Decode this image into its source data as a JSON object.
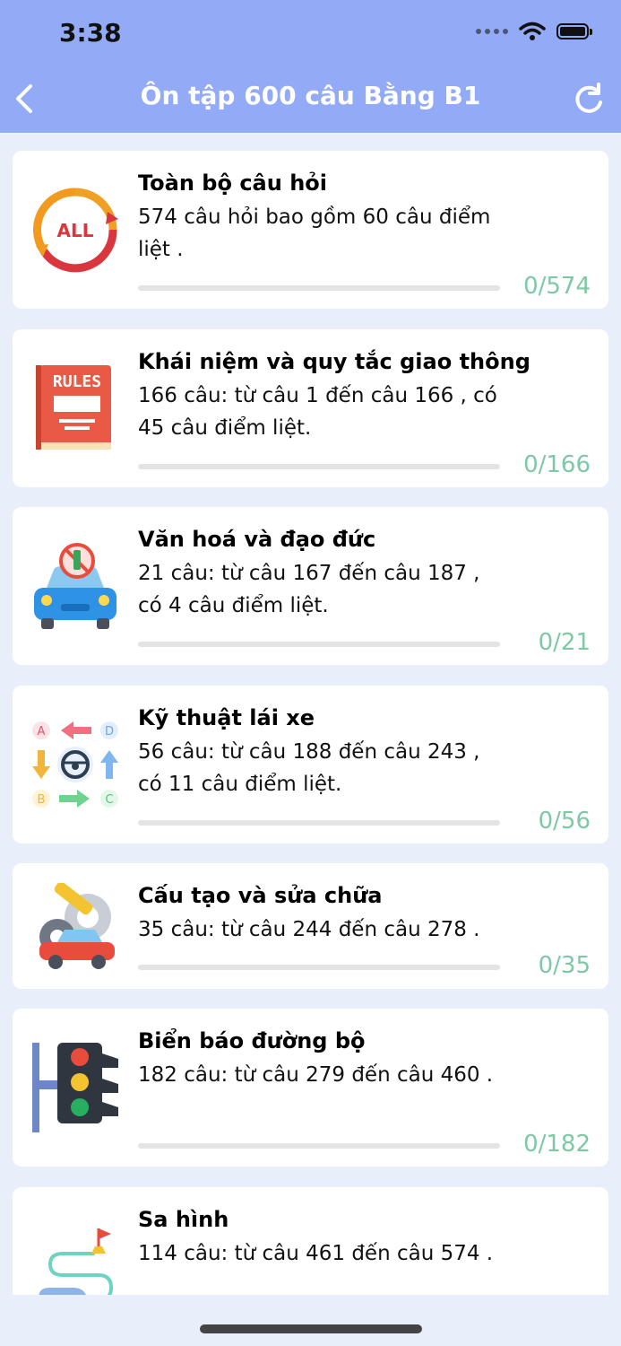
{
  "status_bar": {
    "time": "3:38"
  },
  "nav": {
    "title": "Ôn tập 600 câu Bằng B1"
  },
  "colors": {
    "header": "#93abf6",
    "progress": "#7ec8a5",
    "background": "#e9eefb"
  },
  "categories": [
    {
      "title": "Toàn bộ câu hỏi",
      "desc": "574 câu hỏi bao gồm 60 câu điểm liệt .",
      "count": "0/574",
      "progress": 0,
      "icon": "all-cycle-icon"
    },
    {
      "title": "Khái niệm và quy tắc giao thông",
      "desc": "166 câu: từ câu 1 đến câu 166 , có 45 câu điểm liệt.",
      "count": "0/166",
      "progress": 0,
      "icon": "rules-book-icon"
    },
    {
      "title": "Văn hoá và đạo đức",
      "desc": "21 câu: từ câu 167 đến câu 187 , có 4 câu điểm liệt.",
      "count": "0/21",
      "progress": 0,
      "icon": "car-no-alcohol-icon"
    },
    {
      "title": "Kỹ thuật lái xe",
      "desc": "56 câu: từ câu 188 đến câu 243 , có 11 câu điểm liệt.",
      "count": "0/56",
      "progress": 0,
      "icon": "steering-arrows-icon"
    },
    {
      "title": "Cấu tạo và sửa chữa",
      "desc": "35 câu: từ câu 244 đến câu 278 .",
      "count": "0/35",
      "progress": 0,
      "icon": "car-repair-icon"
    },
    {
      "title": "Biển báo đường bộ",
      "desc": "182 câu: từ câu 279 đến câu 460 .",
      "count": "0/182",
      "progress": 0,
      "icon": "traffic-light-icon"
    },
    {
      "title": "Sa hình",
      "desc": "114 câu: từ câu 461 đến câu 574 .",
      "count": "",
      "progress": 0,
      "icon": "route-map-icon"
    }
  ]
}
